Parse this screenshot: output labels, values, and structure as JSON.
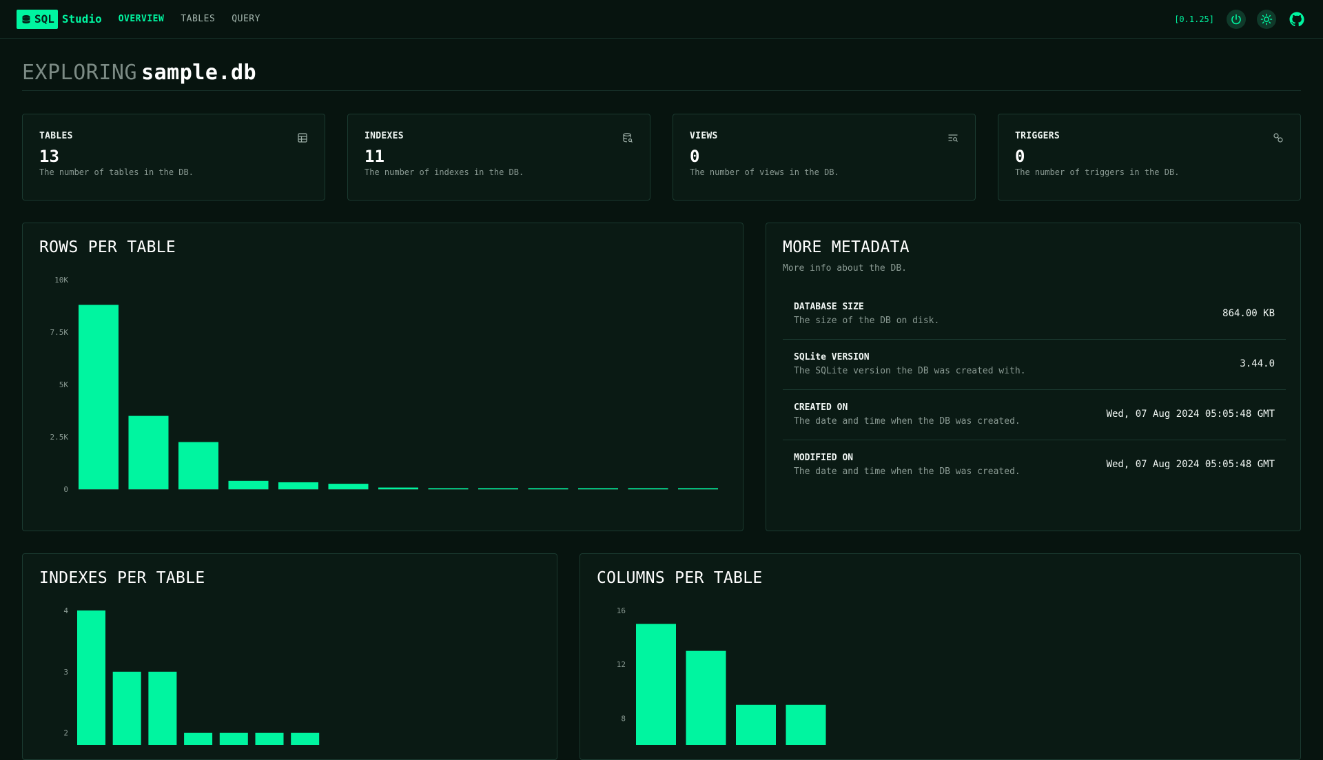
{
  "nav": {
    "logo_badge": "SQL",
    "logo_text": "Studio",
    "links": [
      "OVERVIEW",
      "TABLES",
      "QUERY"
    ],
    "active": "OVERVIEW",
    "version": "[0.1.25]"
  },
  "header": {
    "prefix": "EXPLORING",
    "db_name": "sample.db"
  },
  "stats": [
    {
      "label": "TABLES",
      "value": "13",
      "desc": "The number of tables in the DB.",
      "icon": "table-icon"
    },
    {
      "label": "INDEXES",
      "value": "11",
      "desc": "The number of indexes in the DB.",
      "icon": "database-index-icon"
    },
    {
      "label": "VIEWS",
      "value": "0",
      "desc": "The number of views in the DB.",
      "icon": "list-search-icon"
    },
    {
      "label": "TRIGGERS",
      "value": "0",
      "desc": "The number of triggers in the DB.",
      "icon": "link-icon"
    }
  ],
  "rows_chart": {
    "title": "ROWS PER TABLE"
  },
  "metadata": {
    "title": "MORE METADATA",
    "subtitle": "More info about the DB.",
    "rows": [
      {
        "label": "DATABASE SIZE",
        "desc": "The size of the DB on disk.",
        "value": "864.00 KB"
      },
      {
        "label": "SQLite VERSION",
        "desc": "The SQLite version the DB was created with.",
        "value": "3.44.0"
      },
      {
        "label": "CREATED ON",
        "desc": "The date and time when the DB was created.",
        "value": "Wed, 07 Aug 2024 05:05:48 GMT"
      },
      {
        "label": "MODIFIED ON",
        "desc": "The date and time when the DB was created.",
        "value": "Wed, 07 Aug 2024 05:05:48 GMT"
      }
    ]
  },
  "indexes_chart": {
    "title": "INDEXES PER TABLE"
  },
  "columns_chart": {
    "title": "COLUMNS PER TABLE"
  },
  "colors": {
    "accent": "#00f5a0",
    "background": "#07140f",
    "card": "#0a1a14",
    "border": "#1b3a30"
  },
  "chart_data": [
    {
      "type": "bar",
      "title": "ROWS PER TABLE",
      "values": [
        8800,
        3500,
        2250,
        400,
        330,
        260,
        80,
        40,
        30,
        25,
        15,
        10,
        8
      ],
      "ylim": [
        0,
        10000
      ],
      "yticks": [
        0,
        2500,
        5000,
        7500,
        10000
      ],
      "yticklabels": [
        "0",
        "2.5K",
        "5K",
        "7.5K",
        "10K"
      ],
      "grid": false
    },
    {
      "type": "bar",
      "title": "INDEXES PER TABLE",
      "values": [
        4,
        3,
        3,
        2,
        2,
        2,
        2
      ],
      "yticks": [
        2,
        3,
        4
      ],
      "yticklabels": [
        "2",
        "3",
        "4"
      ],
      "ylim_visible": [
        1.4,
        4
      ]
    },
    {
      "type": "bar",
      "title": "COLUMNS PER TABLE",
      "values": [
        15,
        13,
        9,
        9
      ],
      "yticks": [
        8,
        12,
        16
      ],
      "yticklabels": [
        "8",
        "12",
        "16"
      ],
      "ylim_visible": [
        5,
        16
      ]
    }
  ]
}
